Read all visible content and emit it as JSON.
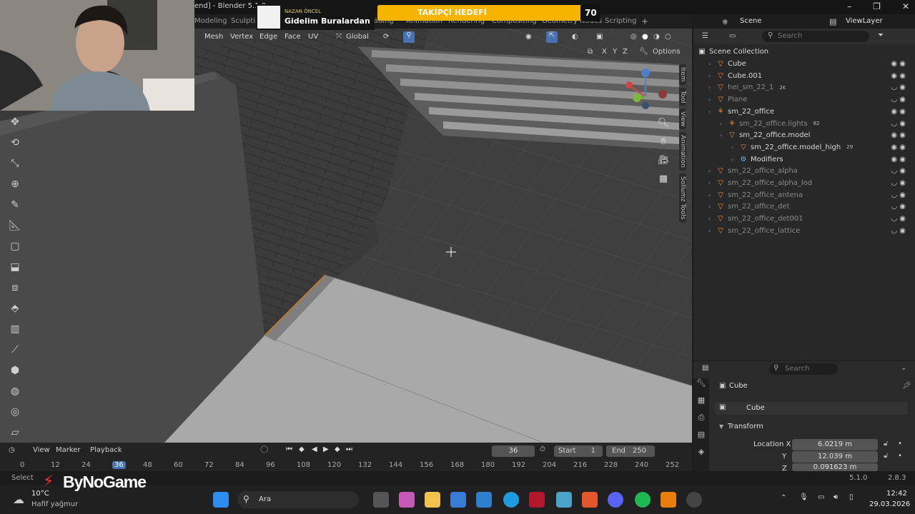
{
  "window": {
    "title": "end] - Blender 5.1.0"
  },
  "workspace_tabs": [
    "Modeling",
    "Sculpting",
    "UV Editing",
    "Texture Paint",
    "Shading",
    "Animation",
    "Rendering",
    "Compositing",
    "Geometry Nodes",
    "Scripting"
  ],
  "scene": {
    "scene_label": "Scene",
    "view_layer_label": "ViewLayer"
  },
  "viewport_header": {
    "menus": [
      "Mesh",
      "Vertex",
      "Edge",
      "Face",
      "UV"
    ],
    "transform_orientation": "Global",
    "options_label": "Options",
    "axes": [
      "X",
      "Y",
      "Z"
    ]
  },
  "side_tabs": [
    "Item",
    "Tool",
    "View",
    "Animation",
    "Sollumz Tools"
  ],
  "outliner": {
    "search_placeholder": "Search",
    "root_label": "Scene Collection",
    "rows": [
      {
        "label": "Cube",
        "dim": false,
        "indent": 1
      },
      {
        "label": "Cube.001",
        "dim": false,
        "indent": 1
      },
      {
        "label": "hei_sm_22_1",
        "dim": true,
        "indent": 1,
        "badge": "2K"
      },
      {
        "label": "Plane",
        "dim": true,
        "indent": 1
      },
      {
        "label": "sm_22_office",
        "dim": false,
        "indent": 1
      },
      {
        "label": "sm_22_office.lights",
        "dim": true,
        "indent": 2,
        "badge": "82"
      },
      {
        "label": "sm_22_office.model",
        "dim": false,
        "indent": 2
      },
      {
        "label": "sm_22_office.model_high",
        "dim": false,
        "indent": 3,
        "badge": "29"
      },
      {
        "label": "Modifiers",
        "dim": false,
        "indent": 3
      },
      {
        "label": "sm_22_office_alpha",
        "dim": true,
        "indent": 1
      },
      {
        "label": "sm_22_office_alpha_lod",
        "dim": true,
        "indent": 1
      },
      {
        "label": "sm_22_office_antena",
        "dim": true,
        "indent": 1
      },
      {
        "label": "sm_22_office_det",
        "dim": true,
        "indent": 1
      },
      {
        "label": "sm_22_office_det001",
        "dim": true,
        "indent": 1
      },
      {
        "label": "sm_22_office_lattice",
        "dim": true,
        "indent": 1
      }
    ]
  },
  "properties": {
    "search_placeholder": "Search",
    "object_name": "Cube",
    "object_name_field": "Cube",
    "panel_transform": "Transform",
    "location_label": "Location X",
    "y_label": "Y",
    "z_label": "Z",
    "location_x": "6.0219 m",
    "location_y": "12.039 m",
    "location_z": "0.091623 m"
  },
  "timeline": {
    "menus": [
      "View",
      "Marker",
      "Playback"
    ],
    "current_frame": "36",
    "start_label": "Start",
    "start_value": "1",
    "end_label": "End",
    "end_value": "250",
    "ticks": [
      "0",
      "12",
      "24",
      "36",
      "48",
      "60",
      "72",
      "84",
      "96",
      "108",
      "120",
      "132",
      "144",
      "156",
      "168",
      "180",
      "192",
      "204",
      "216",
      "228",
      "240",
      "252"
    ]
  },
  "statusbar": {
    "select_label": "Select",
    "version": "5.1.0",
    "version2": "2.8.3"
  },
  "overlay": {
    "follower_goal_label": "TAKİPÇİ HEDEFİ",
    "follower_goal_value": "70",
    "follower_goal_fraction": 0.92,
    "song_artist": "NAZAN ÖNCEL",
    "song_title": "Gidelim Buralardan",
    "channel_logo": "ByNoGame"
  },
  "taskbar": {
    "weather_temp": "10°C",
    "weather_desc": "Hafif yağmur",
    "search_label": "Ara",
    "time": "12:42",
    "date": "29.03.2026"
  }
}
